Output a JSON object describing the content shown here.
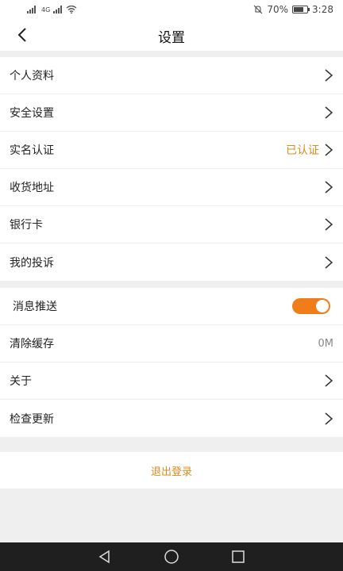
{
  "status_bar": {
    "signal_text": "4G",
    "battery_percent": "70%",
    "time": "3:28"
  },
  "header": {
    "title": "设置"
  },
  "group1": {
    "items": [
      {
        "label": "个人资料"
      },
      {
        "label": "安全设置"
      },
      {
        "label": "实名认证",
        "status": "已认证"
      },
      {
        "label": "收货地址"
      },
      {
        "label": "银行卡"
      },
      {
        "label": "我的投诉"
      }
    ]
  },
  "group2": {
    "push": {
      "label": "消息推送",
      "enabled": true
    },
    "cache": {
      "label": "清除缓存",
      "value": "0M"
    },
    "about": {
      "label": "关于"
    },
    "update": {
      "label": "检查更新"
    }
  },
  "logout_label": "退出登录",
  "colors": {
    "accent": "#f07c1a",
    "accent_text": "#e08a1e",
    "background": "#efefef",
    "system_nav": "#1f1f1f"
  },
  "icons": [
    "signal-icon",
    "wifi-icon",
    "mute-icon",
    "battery-icon",
    "back-icon",
    "chevron-right-icon",
    "back-triangle-icon",
    "home-circle-icon",
    "recents-square-icon"
  ]
}
